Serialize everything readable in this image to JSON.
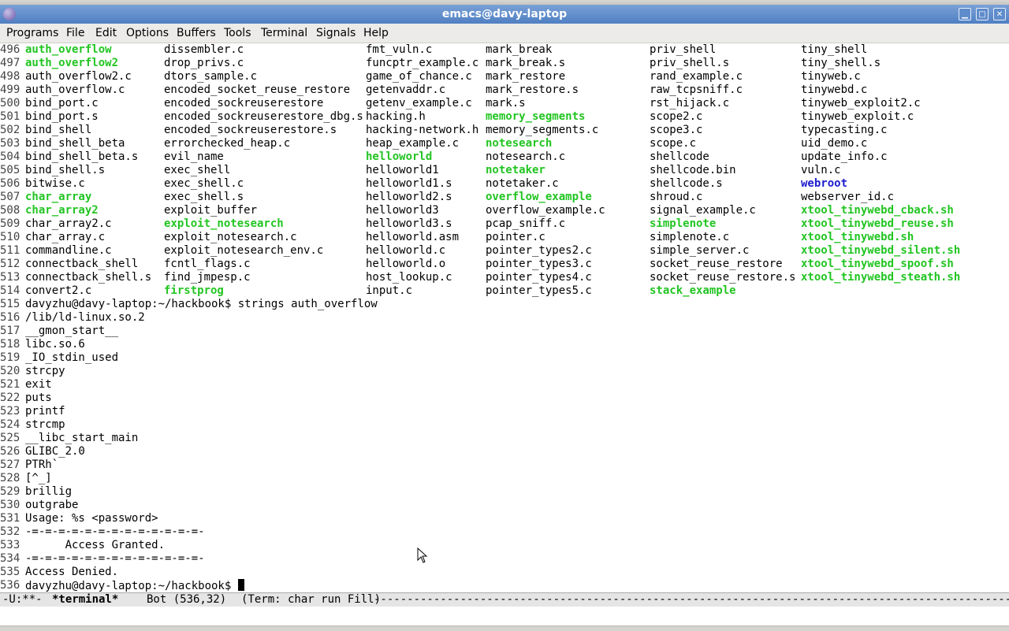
{
  "window": {
    "title": "emacs@davy-laptop"
  },
  "menu": [
    "Programs",
    "File",
    "Edit",
    "Options",
    "Buffers",
    "Tools",
    "Terminal",
    "Signals",
    "Help"
  ],
  "listing": [
    {
      "n": "496",
      "c": [
        {
          "t": "auth_overflow",
          "k": "g"
        },
        {
          "t": "dissembler.c"
        },
        {
          "t": "fmt_vuln.c"
        },
        {
          "t": "mark_break"
        },
        {
          "t": "priv_shell"
        },
        {
          "t": "tiny_shell"
        }
      ]
    },
    {
      "n": "497",
      "c": [
        {
          "t": "auth_overflow2",
          "k": "g"
        },
        {
          "t": "drop_privs.c"
        },
        {
          "t": "funcptr_example.c"
        },
        {
          "t": "mark_break.s"
        },
        {
          "t": "priv_shell.s"
        },
        {
          "t": "tiny_shell.s"
        }
      ]
    },
    {
      "n": "498",
      "c": [
        {
          "t": "auth_overflow2.c"
        },
        {
          "t": "dtors_sample.c"
        },
        {
          "t": "game_of_chance.c"
        },
        {
          "t": "mark_restore"
        },
        {
          "t": "rand_example.c"
        },
        {
          "t": "tinyweb.c"
        }
      ]
    },
    {
      "n": "499",
      "c": [
        {
          "t": "auth_overflow.c"
        },
        {
          "t": "encoded_socket_reuse_restore"
        },
        {
          "t": "getenvaddr.c"
        },
        {
          "t": "mark_restore.s"
        },
        {
          "t": "raw_tcpsniff.c"
        },
        {
          "t": "tinywebd.c"
        }
      ]
    },
    {
      "n": "500",
      "c": [
        {
          "t": "bind_port.c"
        },
        {
          "t": "encoded_sockreuserestore"
        },
        {
          "t": "getenv_example.c"
        },
        {
          "t": "mark.s"
        },
        {
          "t": "rst_hijack.c"
        },
        {
          "t": "tinyweb_exploit2.c"
        }
      ]
    },
    {
      "n": "501",
      "c": [
        {
          "t": "bind_port.s"
        },
        {
          "t": "encoded_sockreuserestore_dbg.s"
        },
        {
          "t": "hacking.h"
        },
        {
          "t": "memory_segments",
          "k": "g"
        },
        {
          "t": "scope2.c"
        },
        {
          "t": "tinyweb_exploit.c"
        }
      ]
    },
    {
      "n": "502",
      "c": [
        {
          "t": "bind_shell"
        },
        {
          "t": "encoded_sockreuserestore.s"
        },
        {
          "t": "hacking-network.h"
        },
        {
          "t": "memory_segments.c"
        },
        {
          "t": "scope3.c"
        },
        {
          "t": "typecasting.c"
        }
      ]
    },
    {
      "n": "503",
      "c": [
        {
          "t": "bind_shell_beta"
        },
        {
          "t": "errorchecked_heap.c"
        },
        {
          "t": "heap_example.c"
        },
        {
          "t": "notesearch",
          "k": "g"
        },
        {
          "t": "scope.c"
        },
        {
          "t": "uid_demo.c"
        }
      ]
    },
    {
      "n": "504",
      "c": [
        {
          "t": "bind_shell_beta.s"
        },
        {
          "t": "evil_name"
        },
        {
          "t": "helloworld",
          "k": "g"
        },
        {
          "t": "notesearch.c"
        },
        {
          "t": "shellcode"
        },
        {
          "t": "update_info.c"
        }
      ]
    },
    {
      "n": "505",
      "c": [
        {
          "t": "bind_shell.s"
        },
        {
          "t": "exec_shell"
        },
        {
          "t": "helloworld1"
        },
        {
          "t": "notetaker",
          "k": "g"
        },
        {
          "t": "shellcode.bin"
        },
        {
          "t": "vuln.c"
        }
      ]
    },
    {
      "n": "506",
      "c": [
        {
          "t": "bitwise.c"
        },
        {
          "t": "exec_shell.c"
        },
        {
          "t": "helloworld1.s"
        },
        {
          "t": "notetaker.c"
        },
        {
          "t": "shellcode.s"
        },
        {
          "t": "webroot",
          "k": "b"
        }
      ]
    },
    {
      "n": "507",
      "c": [
        {
          "t": "char_array",
          "k": "g"
        },
        {
          "t": "exec_shell.s"
        },
        {
          "t": "helloworld2.s"
        },
        {
          "t": "overflow_example",
          "k": "g"
        },
        {
          "t": "shroud.c"
        },
        {
          "t": "webserver_id.c"
        }
      ]
    },
    {
      "n": "508",
      "c": [
        {
          "t": "char_array2",
          "k": "g"
        },
        {
          "t": "exploit_buffer"
        },
        {
          "t": "helloworld3"
        },
        {
          "t": "overflow_example.c"
        },
        {
          "t": "signal_example.c"
        },
        {
          "t": "xtool_tinywebd_cback.sh",
          "k": "g"
        }
      ]
    },
    {
      "n": "509",
      "c": [
        {
          "t": "char_array2.c"
        },
        {
          "t": "exploit_notesearch",
          "k": "g"
        },
        {
          "t": "helloworld3.s"
        },
        {
          "t": "pcap_sniff.c"
        },
        {
          "t": "simplenote",
          "k": "g"
        },
        {
          "t": "xtool_tinywebd_reuse.sh",
          "k": "g"
        }
      ]
    },
    {
      "n": "510",
      "c": [
        {
          "t": "char_array.c"
        },
        {
          "t": "exploit_notesearch.c"
        },
        {
          "t": "helloworld.asm"
        },
        {
          "t": "pointer.c"
        },
        {
          "t": "simplenote.c"
        },
        {
          "t": "xtool_tinywebd.sh",
          "k": "g"
        }
      ]
    },
    {
      "n": "511",
      "c": [
        {
          "t": "commandline.c"
        },
        {
          "t": "exploit_notesearch_env.c"
        },
        {
          "t": "helloworld.c"
        },
        {
          "t": "pointer_types2.c"
        },
        {
          "t": "simple_server.c"
        },
        {
          "t": "xtool_tinywebd_silent.sh",
          "k": "g"
        }
      ]
    },
    {
      "n": "512",
      "c": [
        {
          "t": "connectback_shell"
        },
        {
          "t": "fcntl_flags.c"
        },
        {
          "t": "helloworld.o"
        },
        {
          "t": "pointer_types3.c"
        },
        {
          "t": "socket_reuse_restore"
        },
        {
          "t": "xtool_tinywebd_spoof.sh",
          "k": "g"
        }
      ]
    },
    {
      "n": "513",
      "c": [
        {
          "t": "connectback_shell.s"
        },
        {
          "t": "find_jmpesp.c"
        },
        {
          "t": "host_lookup.c"
        },
        {
          "t": "pointer_types4.c"
        },
        {
          "t": "socket_reuse_restore.s"
        },
        {
          "t": "xtool_tinywebd_steath.sh",
          "k": "g"
        }
      ]
    },
    {
      "n": "514",
      "c": [
        {
          "t": "convert2.c"
        },
        {
          "t": "firstprog",
          "k": "g"
        },
        {
          "t": "input.c"
        },
        {
          "t": "pointer_types5.c"
        },
        {
          "t": "stack_example",
          "k": "g"
        },
        {
          "t": ""
        }
      ]
    }
  ],
  "output": [
    {
      "n": "515",
      "t": "davyzhu@davy-laptop:~/hackbook$ strings auth_overflow"
    },
    {
      "n": "516",
      "t": "/lib/ld-linux.so.2"
    },
    {
      "n": "517",
      "t": "__gmon_start__"
    },
    {
      "n": "518",
      "t": "libc.so.6"
    },
    {
      "n": "519",
      "t": "_IO_stdin_used"
    },
    {
      "n": "520",
      "t": "strcpy"
    },
    {
      "n": "521",
      "t": "exit"
    },
    {
      "n": "522",
      "t": "puts"
    },
    {
      "n": "523",
      "t": "printf"
    },
    {
      "n": "524",
      "t": "strcmp"
    },
    {
      "n": "525",
      "t": "__libc_start_main"
    },
    {
      "n": "526",
      "t": "GLIBC_2.0"
    },
    {
      "n": "527",
      "t": "PTRh`"
    },
    {
      "n": "528",
      "t": "[^_]"
    },
    {
      "n": "529",
      "t": "brillig"
    },
    {
      "n": "530",
      "t": "outgrabe"
    },
    {
      "n": "531",
      "t": "Usage: %s <password>"
    },
    {
      "n": "532",
      "t": "-=-=-=-=-=-=-=-=-=-=-=-=-=-"
    },
    {
      "n": "533",
      "t": "      Access Granted."
    },
    {
      "n": "534",
      "t": "-=-=-=-=-=-=-=-=-=-=-=-=-=-"
    },
    {
      "n": "535",
      "t": "Access Denied."
    },
    {
      "n": "536",
      "t": "davyzhu@davy-laptop:~/hackbook$ "
    }
  ],
  "modeline": {
    "status": "-U:**-",
    "buffer": "*terminal*",
    "position": "Bot (536,32)",
    "mode": "(Term: char run Fill)",
    "fill": "------------------------------------------------------------------------------------------------------------------------------"
  },
  "colors": {
    "green": "#22c522",
    "blue": "#1c1ccf",
    "titlebar": "#5f8ccb"
  },
  "icons": {
    "app": "emacs-icon",
    "minimize": "minimize-icon",
    "maximize": "maximize-icon",
    "close": "close-icon",
    "pointer": "mouse-pointer-icon"
  }
}
